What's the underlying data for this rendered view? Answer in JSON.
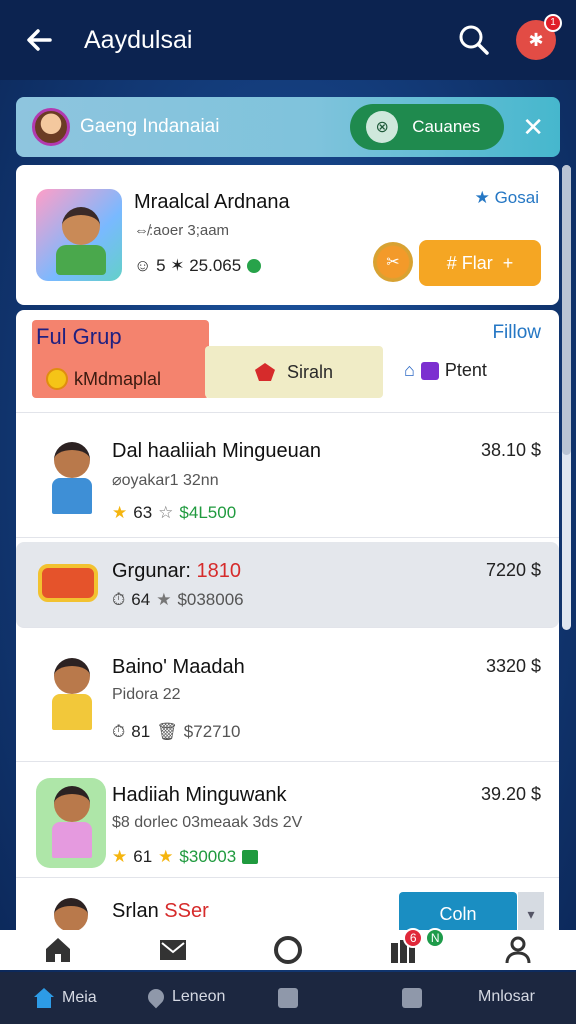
{
  "appbar": {
    "title": "Aaydulsai",
    "back_icon": "arrow-left-icon",
    "search_icon": "search-icon",
    "avatar_icon": "puzzle-icon",
    "notification_count": "1"
  },
  "banner": {
    "text": "Gaeng Indanaiai",
    "button_label": "Cauanes",
    "button_icon": "compass-icon",
    "close_icon": "close-icon"
  },
  "profile": {
    "name": "Mraalcal Ardnana",
    "subtitle": "⇎:aoer 3;aam",
    "stats": "☺ 5 ✶ 25.065",
    "link": "★ Gosai",
    "button_label": "# Flar",
    "button_plus": "+"
  },
  "group": {
    "title": "Ful Grup",
    "subtitle": "kMdmaplal",
    "segment_label": "Siraln",
    "follow_label": "Fillow",
    "ptent_label": "Ptent"
  },
  "list": [
    {
      "title": "Dal haaliiah Mingueuan",
      "subtitle": "⌀oyakar1 32nn",
      "stars": "63",
      "amount": "$4L500",
      "price": "38.10 $"
    },
    {
      "title": "Grgunar:",
      "title_hl": "1810",
      "stars": "64",
      "amount": "$038006",
      "price": "7220 $"
    },
    {
      "title": "Baino' Maadah",
      "subtitle": "Pidora 22",
      "stars": "81",
      "amount": "$72710",
      "price": "3320 $"
    },
    {
      "title": "Hadiiah Minguwank",
      "subtitle": "$8 dorlec 03meaak 3ds 2V",
      "stars": "61",
      "amount": "$30003",
      "price": "39.20 $"
    }
  ],
  "bottom_card": {
    "title": "Srlan",
    "title_hl": "SSer",
    "button_label": "Coln",
    "dropdown_icon": "chevron-down-icon"
  },
  "iconbar": {
    "badge_red": "6",
    "badge_green": "N"
  },
  "nav": {
    "item1": "Meia",
    "item2": "Leneon",
    "item5": "Mnlosar"
  },
  "colors": {
    "appbar": "#0c2350",
    "accent_orange": "#f5a623",
    "accent_green": "#1f8a4e",
    "link_blue": "#2577c4",
    "group_coral": "#f4836e"
  }
}
